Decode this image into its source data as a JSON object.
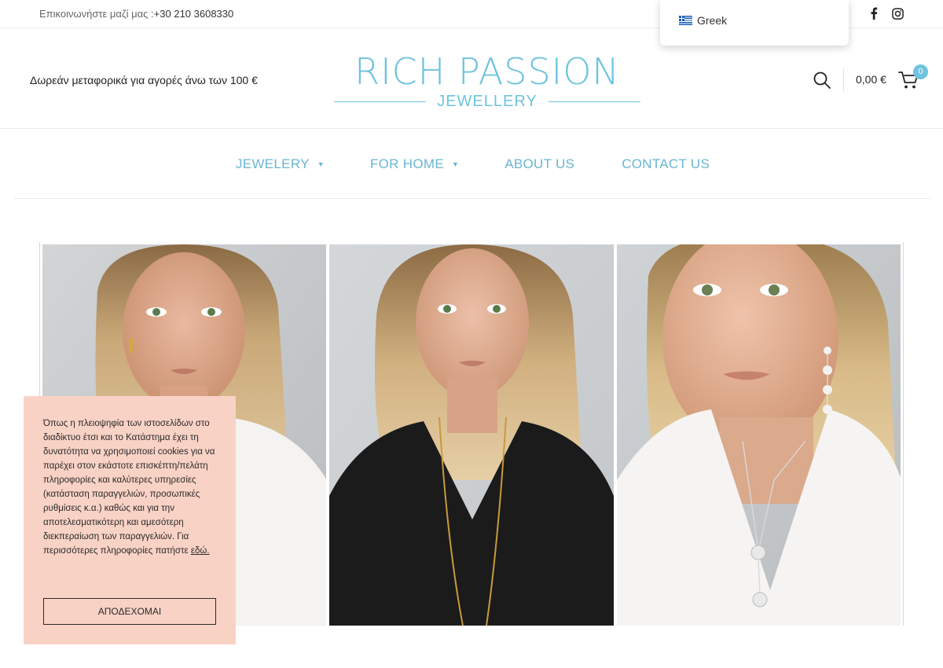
{
  "topbar": {
    "contact_prefix": "Επικοινωνήστε μαζί μας :",
    "contact_phone": "+30 210 3608330",
    "social_icons": [
      "facebook-icon",
      "instagram-icon"
    ]
  },
  "language_dropdown": {
    "option_label": "Greek",
    "flag_icon": "greek-flag-icon"
  },
  "header": {
    "shipping_notice": "Δωρεάν μεταφορικά για αγορές άνω των 100  €",
    "logo_main": "RICH PASSION",
    "logo_sub": "JEWELLERY",
    "cart_total": "0,00  €",
    "cart_count": "0"
  },
  "nav": {
    "items": [
      {
        "label": "JEWELERY",
        "has_dropdown": true
      },
      {
        "label": "FOR HOME",
        "has_dropdown": true
      },
      {
        "label": "ABOUT US",
        "has_dropdown": false
      },
      {
        "label": "CONTACT US",
        "has_dropdown": false
      }
    ]
  },
  "cookie": {
    "text": "Όπως η πλειοψηφία των ιστοσελίδων στο διαδίκτυο έτσι και το Κατάστημα έχει τη δυνατότητα να χρησιμοποιεί cookies για να παρέχει στον εκάστοτε επισκέπτη/πελάτη πληροφορίες και καλύτερες υπηρεσίες (κατάσταση παραγγελιών, προσωπικές ρυθμίσεις κ.α.) καθώς και για την αποτελεσματικότερη και αμεσότερη διεκπεραίωση των παραγγελιών.  Για περισσότερες πληροφορίες πατήστε ",
    "link_text": "εδώ.",
    "accept_label": "ΑΠΟΔΕΧΟΜΑΙ"
  },
  "colors": {
    "accent": "#6ec3de",
    "nav_text": "#6ab6d1",
    "cookie_bg": "#f9d2c6"
  }
}
